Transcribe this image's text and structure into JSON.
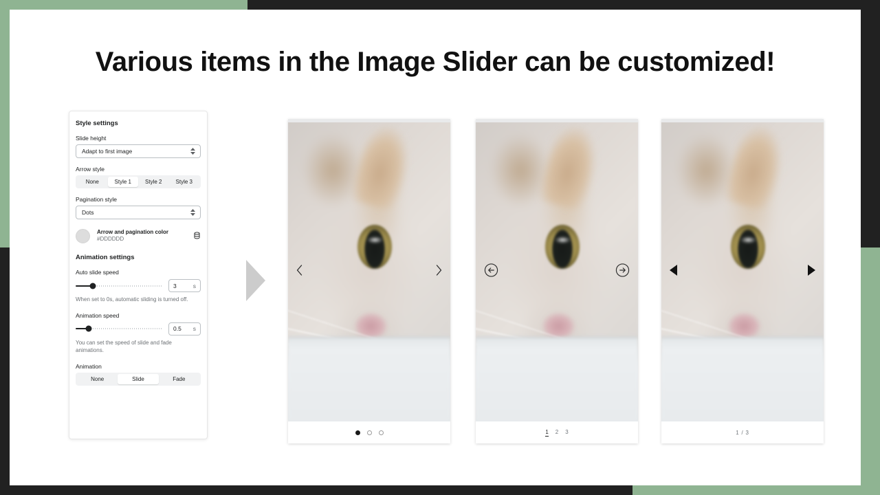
{
  "theme": {
    "accent_green": "#8FB492",
    "backdrop_dark": "#212121",
    "card_white": "#FFFFFF"
  },
  "slide": {
    "title": "Various items in the Image Slider can be customized!"
  },
  "settings_panel": {
    "style_heading": "Style settings",
    "slide_height": {
      "label": "Slide height",
      "value": "Adapt to first image"
    },
    "arrow_style": {
      "label": "Arrow style",
      "options": [
        "None",
        "Style 1",
        "Style 2",
        "Style 3"
      ],
      "selected": "Style 1"
    },
    "pagination_style": {
      "label": "Pagination style",
      "value": "Dots"
    },
    "color": {
      "name": "Arrow and pagination color",
      "hex": "#DDDDDD",
      "swatch_color": "#DDDDDD",
      "icon": "color-library-icon"
    },
    "animation_heading": "Animation settings",
    "auto_slide_speed": {
      "label": "Auto slide speed",
      "value": "3",
      "unit": "s",
      "fill_percent": 20,
      "helper": "When set to 0s, automatic sliding is turned off."
    },
    "animation_speed": {
      "label": "Animation speed",
      "value": "0.5",
      "unit": "s",
      "fill_percent": 15,
      "helper": "You can set the speed of slide and fade animations."
    },
    "animation": {
      "label": "Animation",
      "options": [
        "None",
        "Slide",
        "Fade"
      ],
      "selected": "Slide"
    }
  },
  "previews": [
    {
      "name": "preview-style-1",
      "arrow_style": "Style 1",
      "left_arrow_icon": "chevron-left-icon",
      "right_arrow_icon": "chevron-right-icon",
      "pagination_style": "Dots",
      "dots": [
        "active",
        "inactive",
        "inactive"
      ]
    },
    {
      "name": "preview-style-2",
      "arrow_style": "Style 2",
      "left_arrow_icon": "circle-arrow-left-icon",
      "right_arrow_icon": "circle-arrow-right-icon",
      "pagination_style": "Numbers",
      "numbers": [
        "1",
        "2",
        "3"
      ],
      "active_number": "1"
    },
    {
      "name": "preview-style-3",
      "arrow_style": "Style 3",
      "left_arrow_icon": "triangle-left-icon",
      "right_arrow_icon": "triangle-right-icon",
      "pagination_style": "Fraction",
      "fraction": "1 / 3"
    }
  ]
}
